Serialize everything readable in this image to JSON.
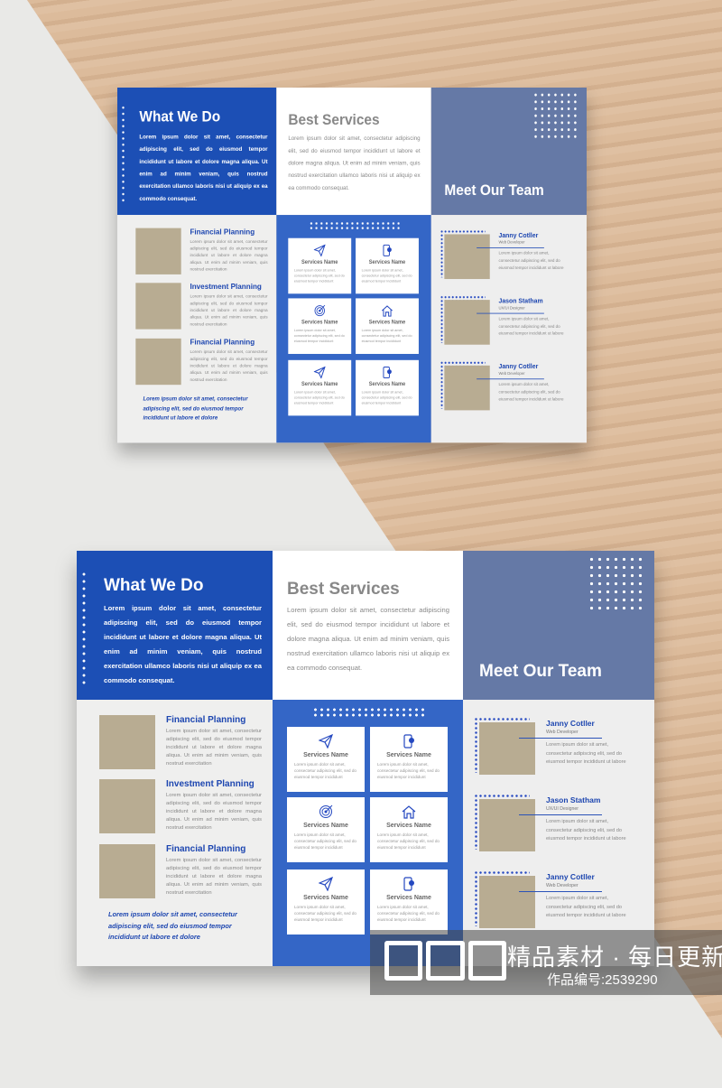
{
  "brochure": {
    "what_we_do": {
      "title": "What We Do",
      "text": "Lorem ipsum dolor sit amet, consectetur adipiscing elit, sed do eiusmod tempor incididunt ut labore et dolore magna aliqua. Ut enim ad minim veniam, quis nostrud exercitation ullamco laboris nisi ut aliquip ex ea commodo consequat."
    },
    "best_services": {
      "title": "Best Services",
      "text": "Lorem ipsum dolor sit amet, consectetur adipiscing elit, sed do eiusmod tempor incididunt ut labore et dolore magna aliqua. Ut enim ad minim veniam, quis nostrud exercitation ullamco laboris nisi ut aliquip ex ea commodo consequat."
    },
    "team_title": "Meet Our Team",
    "planning": [
      {
        "title": "Financial Planning",
        "text": "Lorem ipsum dolor sit amet, consectetur adipiscing elit, sed do eiusmod tempor incididunt ut labore et dolore magna aliqua. Ut enim ad minim veniam, quis nostrud exercitation"
      },
      {
        "title": "Investment Planning",
        "text": "Lorem ipsum dolor sit amet, consectetur adipiscing elit, sed do eiusmod tempor incididunt ut labore et dolore magna aliqua. Ut enim ad minim veniam, quis nostrud exercitation"
      },
      {
        "title": "Financial Planning",
        "text": "Lorem ipsum dolor sit amet, consectetur adipiscing elit, sed do eiusmod tempor incididunt ut labore et dolore magna aliqua. Ut enim ad minim veniam, quis nostrud exercitation"
      }
    ],
    "footnote": "Lorem ipsum dolor sit amet, consectetur adipiscing elit, sed do eiusmod tempor incididunt ut labore et dolore",
    "services": [
      {
        "icon": "paper-plane-icon",
        "name": "Services Name",
        "text": "Lorem ipsum dolor sit amet, consectetur adipiscing elit, sed do eiusmod tempor incididunt"
      },
      {
        "icon": "phone-icon",
        "name": "Services Name",
        "text": "Lorem ipsum dolor sit amet, consectetur adipiscing elit, sed do eiusmod tempor incididunt"
      },
      {
        "icon": "target-icon",
        "name": "Services Name",
        "text": "Lorem ipsum dolor sit amet, consectetur adipiscing elit, sed do eiusmod tempor incididunt"
      },
      {
        "icon": "home-icon",
        "name": "Services Name",
        "text": "Lorem ipsum dolor sit amet, consectetur adipiscing elit, sed do eiusmod tempor incididunt"
      },
      {
        "icon": "paper-plane-icon",
        "name": "Services Name",
        "text": "Lorem ipsum dolor sit amet, consectetur adipiscing elit, sed do eiusmod tempor incididunt"
      },
      {
        "icon": "phone-icon",
        "name": "Services Name",
        "text": "Lorem ipsum dolor sit amet, consectetur adipiscing elit, sed do eiusmod tempor incididunt"
      }
    ],
    "team": [
      {
        "name": "Janny Cotller",
        "role": "Web Developer",
        "text": "Lorem ipsum dolor sit amet, consectetur adipiscing elit, sed do eiusmod tempor incididunt ut labore"
      },
      {
        "name": "Jason Statham",
        "role": "UX/UI Designer",
        "text": "Lorem ipsum dolor sit amet, consectetur adipiscing elit, sed do eiusmod tempor incididunt ut labore"
      },
      {
        "name": "Janny Cotller",
        "role": "Web Developer",
        "text": "Lorem ipsum dolor sit amet, consectetur adipiscing elit, sed do eiusmod tempor incididunt ut labore"
      }
    ]
  },
  "colors": {
    "primary_blue": "#1c4fb5",
    "panel_blue": "#3466c6",
    "slate": "#6579a6",
    "photo_placeholder": "#b8ac92"
  },
  "watermark": {
    "logo": "众图网",
    "slogan": "精品素材 · 每日更新",
    "work_id": "作品编号:2539290"
  }
}
